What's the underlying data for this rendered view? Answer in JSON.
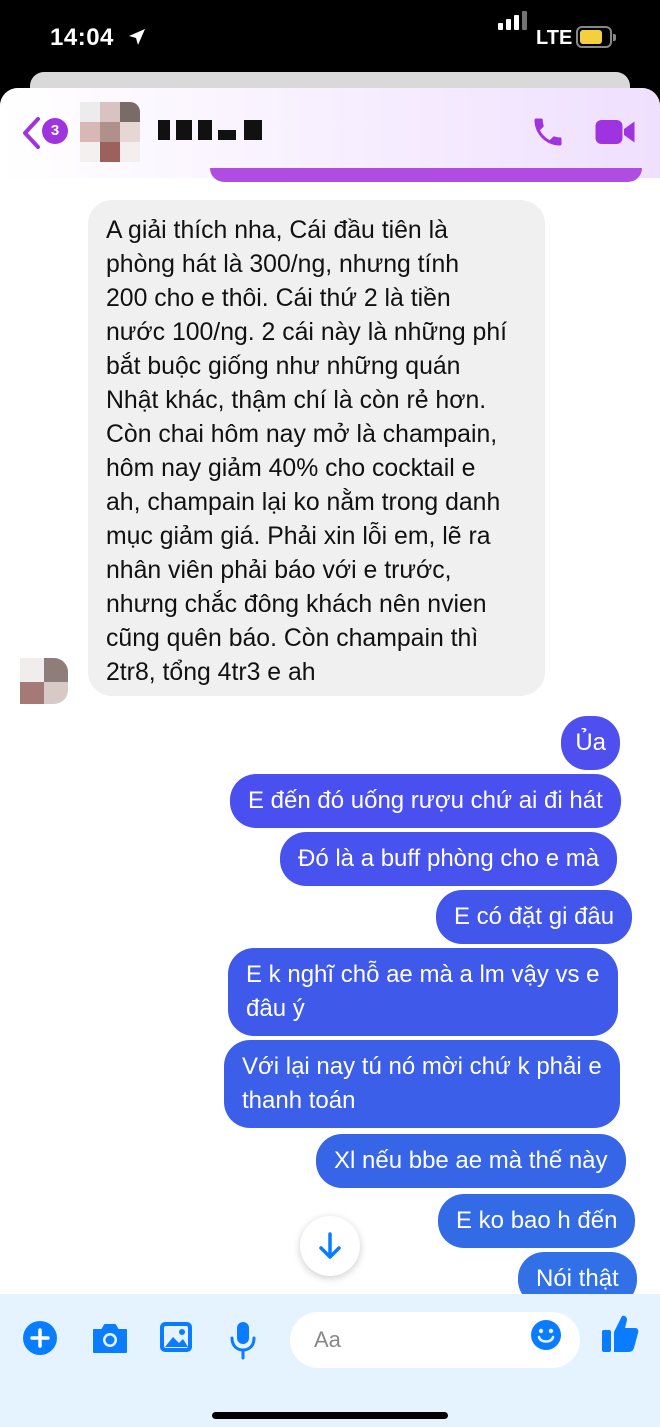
{
  "status": {
    "time": "14:04",
    "network": "LTE"
  },
  "header": {
    "unread_count": "3",
    "icons": {
      "back": "chevron-left-icon",
      "call": "phone-icon",
      "video": "video-camera-icon"
    }
  },
  "incoming_message": {
    "lines": [
      "A giải thích nha, Cái đầu tiên là",
      "phòng hát là 300/ng, nhưng tính",
      "200 cho e thôi. Cái thứ 2 là tiền",
      "nước 100/ng. 2 cái này là những phí",
      "bắt buộc giống như những quán",
      "Nhật khác, thậm chí là còn rẻ hơn.",
      "Còn chai hôm nay mở là champain,",
      "hôm nay giảm 40% cho cocktail e",
      "ah, champain lại ko nằm trong danh",
      "mục giảm giá. Phải xin lỗi em, lẽ ra",
      "nhân viên phải báo với e trước,",
      "nhưng chắc đông khách nên nvien",
      "cũng quên báo. Còn champain thì",
      "2tr8, tổng 4tr3 e ah"
    ]
  },
  "outgoing_messages": [
    {
      "lines": [
        "Ủa"
      ]
    },
    {
      "lines": [
        "E đến đó uống rượu chứ ai đi hát"
      ]
    },
    {
      "lines": [
        "Đó là a buff phòng cho e mà"
      ]
    },
    {
      "lines": [
        "E có đặt gi đâu"
      ]
    },
    {
      "lines": [
        "E k nghĩ chỗ ae mà a lm vậy vs e",
        "đâu ý"
      ]
    },
    {
      "lines": [
        "Với lại nay tú nó mời chứ k phải e",
        "thanh toán"
      ]
    },
    {
      "lines": [
        "Xl nếu bbe ae mà thế này"
      ]
    },
    {
      "lines": [
        "E ko bao h đến"
      ]
    },
    {
      "lines": [
        "Nói thật"
      ]
    }
  ],
  "composer": {
    "placeholder": "Aa",
    "icons": {
      "add": "plus-icon",
      "camera": "camera-icon",
      "gallery": "image-icon",
      "voice": "microphone-icon",
      "emoji": "emoji-icon",
      "like": "thumbs-up-icon",
      "scroll": "arrow-down-icon"
    }
  },
  "colors": {
    "accent": "#0a7cff",
    "outgoing_bubble": "#4a54f0",
    "incoming_bubble": "#f0f0f0",
    "header_purple": "#a033e0"
  }
}
